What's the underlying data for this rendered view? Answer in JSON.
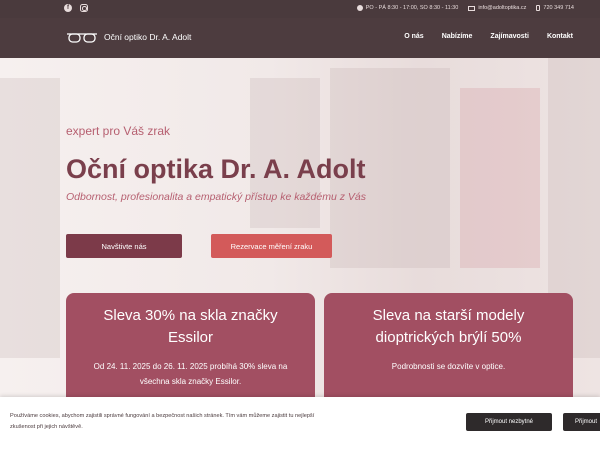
{
  "topbar": {
    "social": [
      "facebook-icon",
      "instagram-icon"
    ],
    "hours": "PO - PÁ 8:30 - 17:00, SO 8:30 - 11:30",
    "email": "info@adoltoptika.cz",
    "phone": "720 349 714"
  },
  "nav": {
    "logo_text": "Oční optiko Dr. A. Adolt",
    "menu": [
      "O nás",
      "Nabízíme",
      "Zajímavosti",
      "Kontakt"
    ]
  },
  "hero": {
    "tagline": "expert pro Váš zrak",
    "title": "Oční optika Dr. A. Adolt",
    "subtitle": "Odbornost, profesionalita a empatický přístup ke každému z Vás",
    "btn_visit": "Navštivte nás",
    "btn_reserve": "Rezervace měření zraku"
  },
  "cards": [
    {
      "title": "Sleva 30% na skla značky Essilor",
      "text": "Od 24. 11. 2025 do 26. 11. 2025 probíhá 30% sleva na všechna skla značky Essilor."
    },
    {
      "title": "Sleva na starší modely dioptrických brýlí 50%",
      "text": "Podrobnosti se dozvíte v optice."
    }
  ],
  "cookie": {
    "text": "Používáme cookies, abychom zajistili správné fungování a bezpečnost našich stránek. Tím vám můžeme zajistit tu nejlepší zkušenost při jejich návštěvě.",
    "btn_necessary": "Přijmout nezbytné",
    "btn_all": "Přijmout"
  },
  "colors": {
    "topbar": "#4a3a3d",
    "accent": "#7c3a49",
    "card": "#a24f62",
    "reserve": "#d35a5a"
  }
}
